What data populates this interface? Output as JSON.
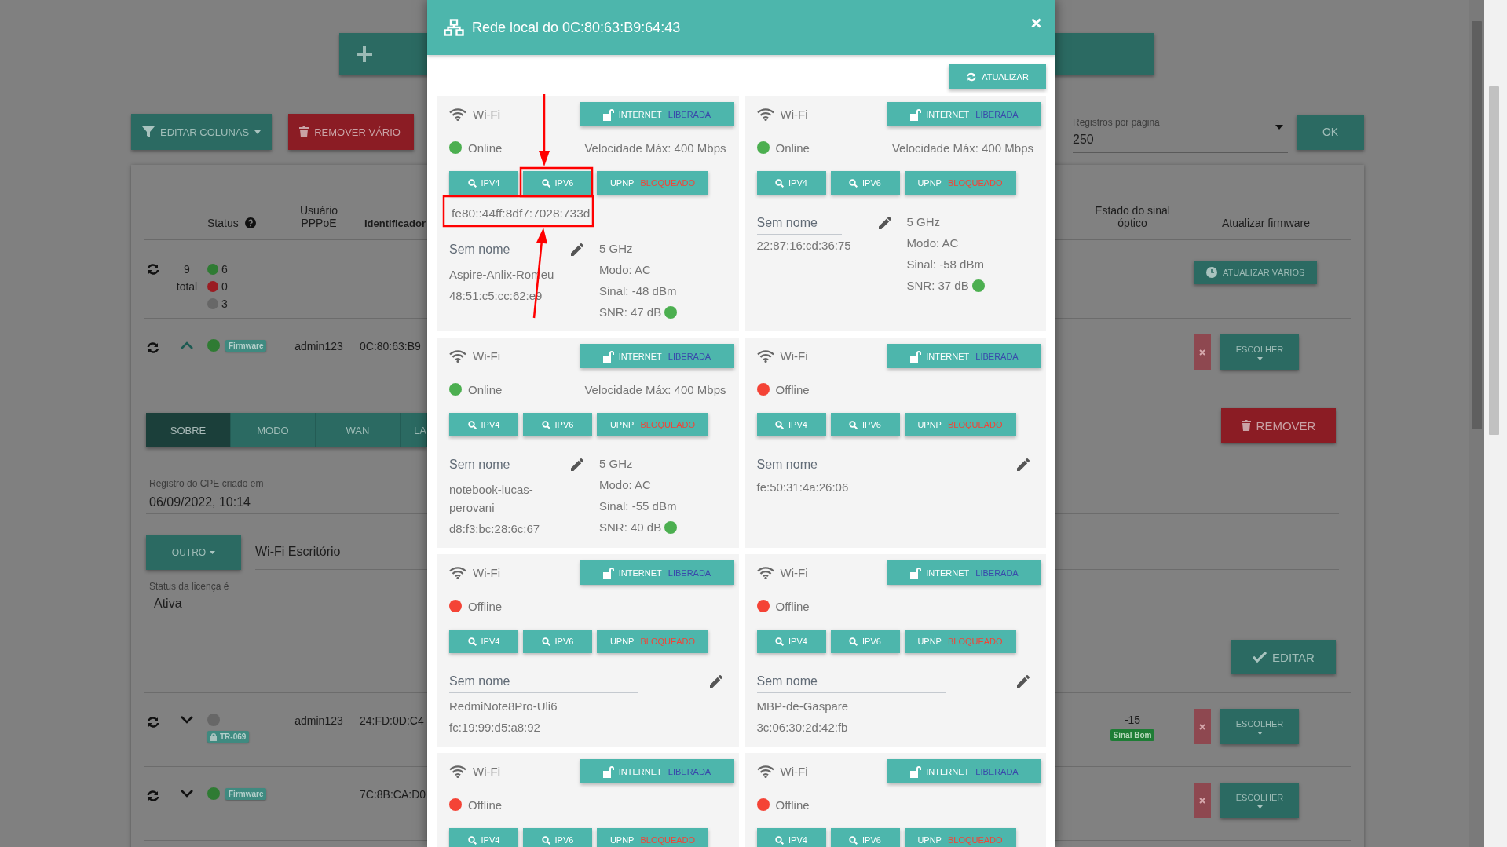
{
  "page": {
    "toolbar": [
      {
        "kind": "filter",
        "label": "EDITAR COLUNAS",
        "dropdown": true
      },
      {
        "kind": "delete",
        "label": "REMOVER VÁRIO",
        "dropdown": false
      }
    ],
    "per_page": {
      "label": "Registros por página",
      "value": "250"
    },
    "ok_button": "OK",
    "table": {
      "columns": [
        {
          "label": "Status"
        },
        {
          "label": "Usuário PPPoE"
        },
        {
          "label": "Identificador"
        },
        {
          "label": "Estado do sinal óptico"
        },
        {
          "label": "Atualizar firmware"
        }
      ],
      "summary": {
        "total": "9",
        "total_label": "total",
        "counts": [
          {
            "color": "#2f7b33",
            "count": "6"
          },
          {
            "color": "#9a1c22",
            "count": "0"
          },
          {
            "color": "#676767",
            "count": "3"
          }
        ],
        "update_button": "ATUALIZAR VÁRIOS"
      },
      "rows": [
        {
          "expanded": true,
          "color": "#2f7b33",
          "badge": {
            "kind": "firmware",
            "label": "Firmware"
          },
          "user": "admin123",
          "identifier": "0C:80:63:B9",
          "firmware_button": "ESCOLHER",
          "details": {
            "tabs": [
              {
                "label": "SOBRE",
                "selected": true
              },
              {
                "label": "MODO",
                "selected": false
              },
              {
                "label": "WAN",
                "selected": false
              },
              {
                "label": "LA",
                "selected": false
              }
            ],
            "remove_button": "REMOVER",
            "created": {
              "label": "Registro do CPE criado em",
              "value": "06/09/2022, 10:14"
            },
            "type_button": "OUTRO",
            "type_value": "Wi-Fi Escritório",
            "license": {
              "label": "Status da licença é",
              "value": "Ativa"
            },
            "edit_button": "EDITAR"
          }
        },
        {
          "expanded": false,
          "color": "#676767",
          "badge": {
            "kind": "tr069",
            "label": "TR-069"
          },
          "user": "admin123",
          "identifier": "24:FD:0D:C4",
          "optical": {
            "value": "-15",
            "label": "Sinal Bom"
          },
          "firmware_button": "ESCOLHER"
        },
        {
          "expanded": false,
          "color": "#2f7b33",
          "badge": {
            "kind": "firmware",
            "label": "Firmware"
          },
          "identifier": "7C:8B:CA:D0",
          "firmware_button": "ESCOLHER"
        }
      ]
    }
  },
  "modal": {
    "title": "Rede local do 0C:80:63:B9:64:43",
    "refresh_button": "ATUALIZAR",
    "devices": [
      {
        "connection": "Wi-Fi",
        "internet": {
          "label": "INTERNET",
          "state": "LIBERADA",
          "allowed": true
        },
        "online": true,
        "status": "Online",
        "speed": "Velocidade Máx: 400 Mbps",
        "ipv4_button": "IPV4",
        "ipv6_button": "IPV6",
        "upnp": {
          "label": "UPNP",
          "state": "BLOQUEADO",
          "allowed": false
        },
        "ipv6_address": "fe80::44ff:8df7:7028:733d",
        "name_field": {
          "placeholder": "Sem nome"
        },
        "hostname": "Aspire-Anlix-Romeu",
        "mac": "48:51:c5:cc:62:e9",
        "details": {
          "band": "5 GHz",
          "mode": "Modo: AC",
          "signal": "Sinal: -48 dBm",
          "snr": "SNR: 47 dB",
          "snr_good": true
        }
      },
      {
        "connection": "Wi-Fi",
        "internet": {
          "label": "INTERNET",
          "state": "LIBERADA",
          "allowed": true
        },
        "online": true,
        "status": "Online",
        "speed": "Velocidade Máx: 400 Mbps",
        "ipv4_button": "IPV4",
        "ipv6_button": "IPV6",
        "upnp": {
          "label": "UPNP",
          "state": "BLOQUEADO",
          "allowed": false
        },
        "name_field": {
          "placeholder": "Sem nome"
        },
        "mac": "22:87:16:cd:36:75",
        "details": {
          "band": "5 GHz",
          "mode": "Modo: AC",
          "signal": "Sinal: -58 dBm",
          "snr": "SNR: 37 dB",
          "snr_good": true
        }
      },
      {
        "connection": "Wi-Fi",
        "internet": {
          "label": "INTERNET",
          "state": "LIBERADA",
          "allowed": true
        },
        "online": true,
        "status": "Online",
        "speed": "Velocidade Máx: 400 Mbps",
        "ipv4_button": "IPV4",
        "ipv6_button": "IPV6",
        "upnp": {
          "label": "UPNP",
          "state": "BLOQUEADO",
          "allowed": false
        },
        "name_field": {
          "placeholder": "Sem nome"
        },
        "hostname": "notebook-lucas-perovani",
        "mac": "d8:f3:bc:28:6c:67",
        "details": {
          "band": "5 GHz",
          "mode": "Modo: AC",
          "signal": "Sinal: -55 dBm",
          "snr": "SNR: 40 dB",
          "snr_good": true
        }
      },
      {
        "connection": "Wi-Fi",
        "internet": {
          "label": "INTERNET",
          "state": "LIBERADA",
          "allowed": true
        },
        "online": false,
        "status": "Offline",
        "ipv4_button": "IPV4",
        "ipv6_button": "IPV6",
        "upnp": {
          "label": "UPNP",
          "state": "BLOQUEADO",
          "allowed": false
        },
        "name_field": {
          "placeholder": "Sem nome"
        },
        "mac": "fe:50:31:4a:26:06"
      },
      {
        "connection": "Wi-Fi",
        "internet": {
          "label": "INTERNET",
          "state": "LIBERADA",
          "allowed": true
        },
        "online": false,
        "status": "Offline",
        "ipv4_button": "IPV4",
        "ipv6_button": "IPV6",
        "upnp": {
          "label": "UPNP",
          "state": "BLOQUEADO",
          "allowed": false
        },
        "name_field": {
          "placeholder": "Sem nome"
        },
        "hostname": "RedmiNote8Pro-Uli6",
        "mac": "fc:19:99:d5:a8:92"
      },
      {
        "connection": "Wi-Fi",
        "internet": {
          "label": "INTERNET",
          "state": "LIBERADA",
          "allowed": true
        },
        "online": false,
        "status": "Offline",
        "ipv4_button": "IPV4",
        "ipv6_button": "IPV6",
        "upnp": {
          "label": "UPNP",
          "state": "BLOQUEADO",
          "allowed": false
        },
        "name_field": {
          "placeholder": "Sem nome"
        },
        "hostname": "MBP-de-Gaspare",
        "mac": "3c:06:30:2d:42:fb"
      },
      {
        "connection": "Wi-Fi",
        "internet": {
          "label": "INTERNET",
          "state": "LIBERADA",
          "allowed": true
        },
        "online": false,
        "status": "Offline",
        "ipv4_button": "IPV4",
        "ipv6_button": "IPV6",
        "upnp": {
          "label": "UPNP",
          "state": "BLOQUEADO",
          "allowed": false
        }
      },
      {
        "connection": "Wi-Fi",
        "internet": {
          "label": "INTERNET",
          "state": "LIBERADA",
          "allowed": true
        },
        "online": false,
        "status": "Offline",
        "ipv4_button": "IPV4",
        "ipv6_button": "IPV6",
        "upnp": {
          "label": "UPNP",
          "state": "BLOQUEADO",
          "allowed": false
        }
      }
    ]
  }
}
